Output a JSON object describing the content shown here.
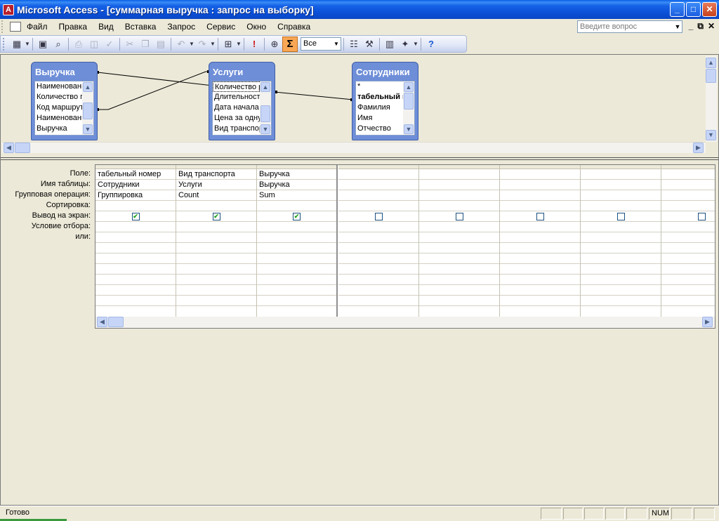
{
  "window": {
    "title": "Microsoft Access - [суммарная выручка : запрос на выборку]",
    "buttons": {
      "minimize": "_",
      "maximize": "□",
      "close": "✕"
    }
  },
  "menubar": {
    "items": [
      "Файл",
      "Правка",
      "Вид",
      "Вставка",
      "Запрос",
      "Сервис",
      "Окно",
      "Справка"
    ],
    "help_placeholder": "Введите вопрос"
  },
  "toolbar": {
    "top_values_select": "Все"
  },
  "tables": [
    {
      "name": "Выручка",
      "fields": [
        "Наименовани",
        "Количество п",
        "Код маршрут",
        "Наименовани",
        "Выручка"
      ],
      "selected_index": -1
    },
    {
      "name": "Услуги",
      "fields": [
        "Количество р",
        "Длительност",
        "Дата начала",
        "Цена за одну",
        "Вид транспор"
      ],
      "selected_index": 0
    },
    {
      "name": "Сотрудники",
      "fields": [
        "*",
        "табельный н",
        "Фамилия",
        "Имя",
        "Отчество"
      ],
      "selected_index": -1,
      "bold_index": 1
    }
  ],
  "grid": {
    "row_labels": [
      "Поле:",
      "Имя таблицы:",
      "Групповая операция:",
      "Сортировка:",
      "Вывод на экран:",
      "Условие отбора:",
      "или:"
    ],
    "columns": [
      {
        "field": "табельный номер",
        "table": "Сотрудники",
        "total": "Группировка",
        "sort": "",
        "show": true
      },
      {
        "field": "Вид транспорта",
        "table": "Услуги",
        "total": "Count",
        "sort": "",
        "show": true
      },
      {
        "field": "Выручка",
        "table": "Выручка",
        "total": "Sum",
        "sort": "",
        "show": true
      },
      {
        "field": "",
        "table": "",
        "total": "",
        "sort": "",
        "show": false
      },
      {
        "field": "",
        "table": "",
        "total": "",
        "sort": "",
        "show": false
      },
      {
        "field": "",
        "table": "",
        "total": "",
        "sort": "",
        "show": false
      },
      {
        "field": "",
        "table": "",
        "total": "",
        "sort": "",
        "show": false
      },
      {
        "field": "",
        "table": "",
        "total": "",
        "sort": "",
        "show": false
      }
    ]
  },
  "statusbar": {
    "text": "Готово",
    "num": "NUM"
  }
}
